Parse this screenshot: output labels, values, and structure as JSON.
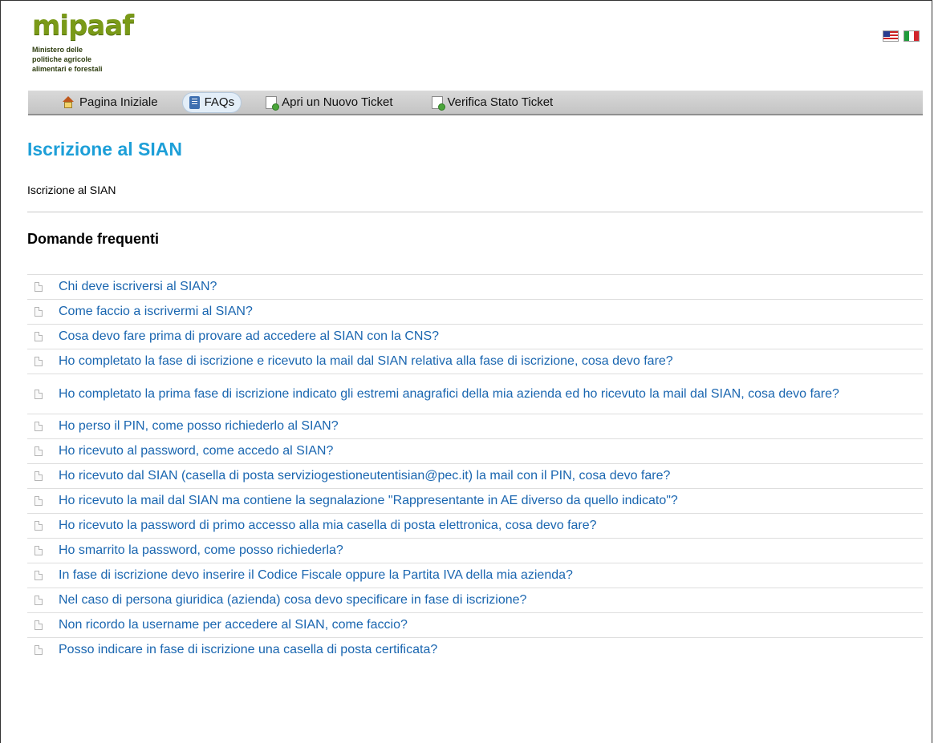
{
  "header": {
    "logo_text": "mipaaf",
    "logo_subtitle_lines": [
      "Ministero delle",
      "politiche agricole",
      "alimentari e forestali"
    ],
    "flags": [
      {
        "name": "us-flag",
        "colors": [
          "#c22222",
          "#ffffff",
          "#2a3d8f"
        ]
      },
      {
        "name": "it-flag",
        "colors": [
          "#1f9a3a",
          "#ffffff",
          "#d2232a"
        ]
      }
    ]
  },
  "nav": {
    "items": [
      {
        "label": "Pagina Iniziale",
        "icon": "home-icon",
        "active": false
      },
      {
        "label": "FAQs",
        "icon": "book-icon",
        "active": true
      },
      {
        "label": "Apri un Nuovo Ticket",
        "icon": "new-ticket-icon",
        "active": false
      },
      {
        "label": "Verifica Stato Ticket",
        "icon": "check-ticket-icon",
        "active": false
      }
    ]
  },
  "main": {
    "title": "Iscrizione al SIAN",
    "description": "Iscrizione al SIAN",
    "section_title": "Domande frequenti",
    "faqs": [
      "Chi deve iscriversi al SIAN?",
      "Come faccio a iscrivermi al SIAN?",
      "Cosa devo fare prima di provare ad accedere al SIAN con la CNS?",
      "Ho completato la fase di iscrizione e ricevuto la mail dal SIAN relativa alla fase di iscrizione, cosa devo fare?",
      "Ho completato la prima fase di iscrizione indicato gli estremi anagrafici della mia azienda ed ho ricevuto la mail dal SIAN, cosa devo fare?",
      "Ho perso il PIN, come posso richiederlo al SIAN?",
      "Ho ricevuto al password, come accedo al SIAN?",
      "Ho ricevuto dal SIAN (casella di posta serviziogestioneutentisian@pec.it) la mail con il PIN, cosa devo fare?",
      "Ho ricevuto la mail dal SIAN ma contiene la segnalazione \"Rappresentante in AE diverso da quello indicato\"?",
      "Ho ricevuto la password di primo accesso alla mia casella di posta elettronica, cosa devo fare?",
      "Ho smarrito la password, come posso richiederla?",
      "In fase di iscrizione devo inserire il Codice Fiscale oppure la Partita IVA della mia azienda?",
      "Nel caso di persona giuridica (azienda) cosa devo specificare in fase di iscrizione?",
      "Non ricordo la username per accedere al SIAN, come faccio?",
      "Posso indicare in fase di iscrizione una casella di posta certificata?"
    ]
  },
  "colors": {
    "title": "#1d9fd8",
    "link": "#1a66b0",
    "logo": "#7a9a18"
  }
}
